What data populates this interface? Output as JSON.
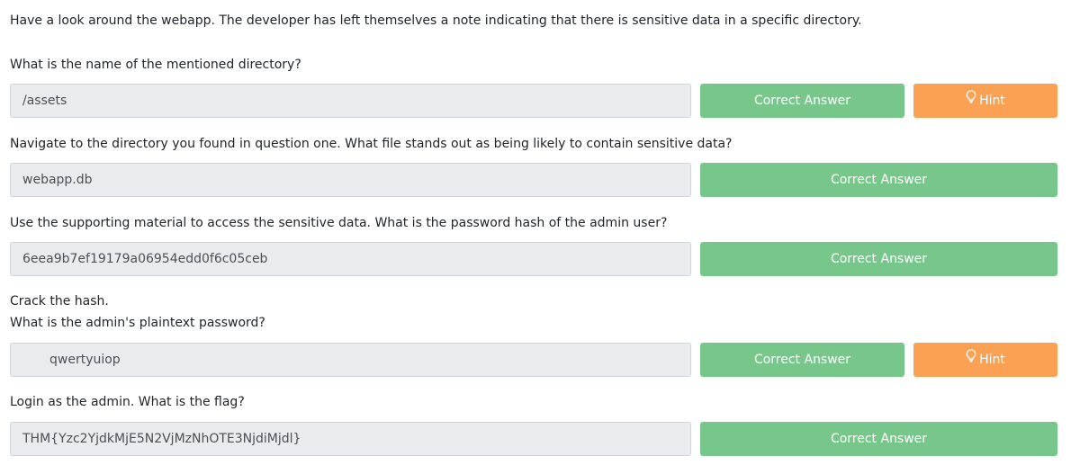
{
  "intro": "Have a look around the webapp. The developer has left themselves a note indicating that there is sensitive data in a specific directory.",
  "questions": [
    {
      "lines": [
        "What is the name of the mentioned directory?"
      ],
      "answer": "/assets",
      "button_label": "Correct Answer",
      "hint_label": "Hint"
    },
    {
      "lines": [
        "Navigate to the directory you found in question one. What file stands out as being likely to contain sensitive data?"
      ],
      "answer": "webapp.db",
      "button_label": "Correct Answer"
    },
    {
      "lines": [
        "Use the supporting material to access the sensitive data. What is the password hash of the admin user?"
      ],
      "answer": "6eea9b7ef19179a06954edd0f6c05ceb",
      "button_label": "Correct Answer"
    },
    {
      "lines": [
        "Crack the hash.",
        "What is the admin's plaintext password?"
      ],
      "answer": "qwertyuiop",
      "button_label": "Correct Answer",
      "hint_label": "Hint"
    },
    {
      "lines": [
        "Login as the admin. What is the flag?"
      ],
      "answer": "THM{Yzc2YjdkMjE5N2VjMzNhOTE3NjdiMjdl}",
      "button_label": "Correct Answer"
    }
  ],
  "icons": {
    "hint": "lightbulb-icon"
  },
  "colors": {
    "correct": "#77c78a",
    "hint": "#fba154",
    "input_bg": "#e9ecef"
  }
}
